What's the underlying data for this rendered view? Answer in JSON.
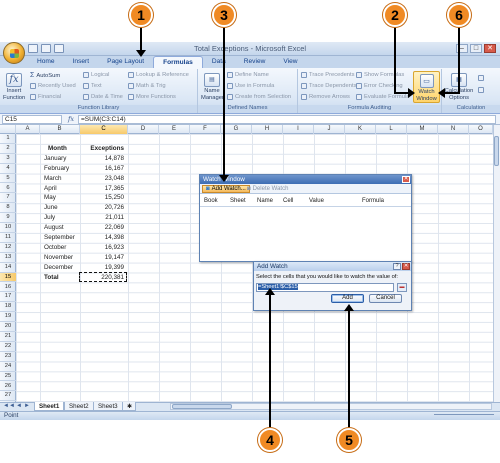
{
  "window": {
    "title": "Total Exceptions - Microsoft Excel"
  },
  "win_controls": {
    "minimize": "–",
    "maximize": "□",
    "close": "✕"
  },
  "tabs": [
    {
      "label": "Home"
    },
    {
      "label": "Insert"
    },
    {
      "label": "Page Layout"
    },
    {
      "label": "Formulas"
    },
    {
      "label": "Data"
    },
    {
      "label": "Review"
    },
    {
      "label": "View"
    }
  ],
  "ribbon": {
    "function_library": {
      "label": "Function Library",
      "insert_function": "Insert Function",
      "autosum": "AutoSum",
      "recently_used": "Recently Used",
      "financial": "Financial",
      "logical": "Logical",
      "text": "Text",
      "date_time": "Date & Time",
      "lookup_reference": "Lookup & Reference",
      "math_trig": "Math & Trig",
      "more_functions": "More Functions"
    },
    "defined_names": {
      "label": "Defined Names",
      "name_manager": "Name Manager",
      "define_name": "Define Name",
      "use_in_formula": "Use in Formula",
      "create_from_selection": "Create from Selection"
    },
    "formula_auditing": {
      "label": "Formula Auditing",
      "trace_precedents": "Trace Precedents",
      "trace_dependents": "Trace Dependents",
      "remove_arrows": "Remove Arrows",
      "show_formulas": "Show Formulas",
      "error_checking": "Error Checking",
      "evaluate_formula": "Evaluate Formula",
      "watch_window": "Watch Window"
    },
    "calculation": {
      "label": "Calculation",
      "calculation_options": "Calculation Options"
    }
  },
  "formula_bar": {
    "name_box": "C15",
    "fx": "fx",
    "content": "=SUM(C3:C14)"
  },
  "columns": [
    "A",
    "B",
    "C",
    "D",
    "E",
    "F",
    "G",
    "H",
    "I",
    "J",
    "K",
    "L",
    "M",
    "N",
    "O"
  ],
  "rows": [
    "1",
    "2",
    "3",
    "4",
    "5",
    "6",
    "7",
    "8",
    "9",
    "10",
    "11",
    "12",
    "13",
    "14",
    "15",
    "16",
    "17",
    "18",
    "19",
    "20",
    "21",
    "22",
    "23",
    "24",
    "25",
    "26",
    "27"
  ],
  "sheet": {
    "header_month": "Month",
    "header_exceptions": "Exceptions",
    "data": [
      {
        "month": "January",
        "value": "14,878"
      },
      {
        "month": "February",
        "value": "16,167"
      },
      {
        "month": "March",
        "value": "23,048"
      },
      {
        "month": "April",
        "value": "17,365"
      },
      {
        "month": "May",
        "value": "15,250"
      },
      {
        "month": "June",
        "value": "20,726"
      },
      {
        "month": "July",
        "value": "21,011"
      },
      {
        "month": "August",
        "value": "22,069"
      },
      {
        "month": "September",
        "value": "14,398"
      },
      {
        "month": "October",
        "value": "16,923"
      },
      {
        "month": "November",
        "value": "19,147"
      },
      {
        "month": "December",
        "value": "19,399"
      }
    ],
    "total_label": "Total",
    "total_value": "220,381"
  },
  "sheet_tabs": [
    "Sheet1",
    "Sheet2",
    "Sheet3"
  ],
  "status": {
    "mode": "Point"
  },
  "watch_window": {
    "title": "Watch Window",
    "add_watch": "Add Watch...",
    "delete_watch": "Delete Watch",
    "columns": [
      "Book",
      "Sheet",
      "Name",
      "Cell",
      "Value",
      "Formula"
    ]
  },
  "add_watch_dialog": {
    "title": "Add Watch",
    "prompt": "Select the cells that you would like to watch the value of:",
    "value": "=Sheet1!$C$15",
    "add_button": "Add",
    "cancel_button": "Cancel",
    "help": "?",
    "close": "✕"
  },
  "callouts": [
    "1",
    "2",
    "3",
    "4",
    "5",
    "6"
  ]
}
